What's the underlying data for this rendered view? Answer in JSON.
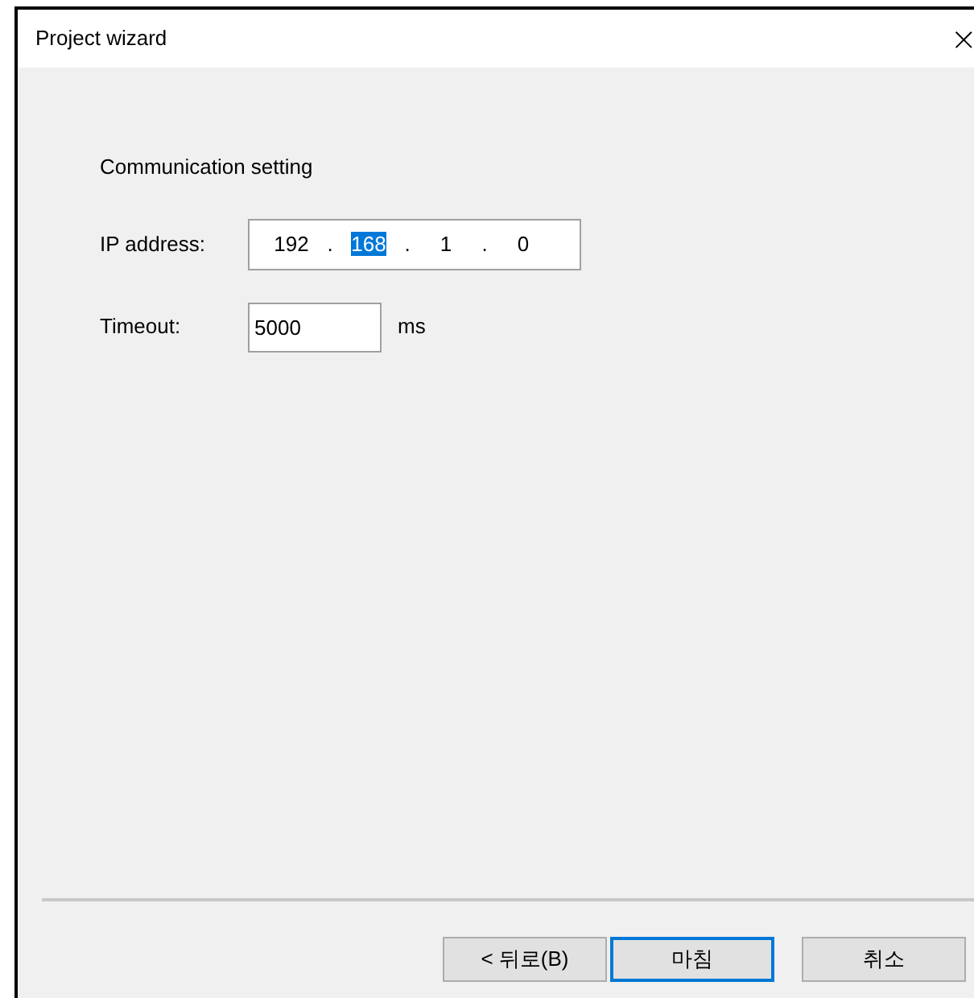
{
  "window": {
    "title": "Project wizard",
    "close": "×"
  },
  "section_title": "Communication setting",
  "ip_address": {
    "label": "IP address:",
    "octets": [
      {
        "value": "192",
        "selected": false
      },
      {
        "value": "168",
        "selected": true
      },
      {
        "value": "1",
        "selected": false
      },
      {
        "value": "0",
        "selected": false
      }
    ],
    "separator": "."
  },
  "timeout": {
    "label": "Timeout:",
    "value": "5000",
    "unit": "ms"
  },
  "buttons": [
    {
      "label": "< 뒤로(B)",
      "default": false
    },
    {
      "label": "마침",
      "default": true
    },
    {
      "label": "취소",
      "default": false
    }
  ]
}
